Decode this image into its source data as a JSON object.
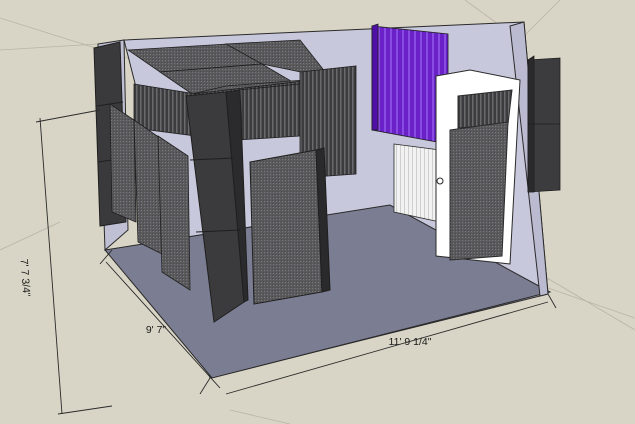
{
  "dimensions": {
    "height": "7' 7 3/4\"",
    "depth": "9' 7\"",
    "width": "11' 9 1/4\""
  },
  "colors": {
    "background": "#d9d5c6",
    "wall": "#c9c9dd",
    "floor": "#7e8094",
    "foam_dark": "#3d3d3f",
    "foam_panel": "#5e5e61",
    "purple_foam": "#6a22c8",
    "door": "#ffffff"
  }
}
